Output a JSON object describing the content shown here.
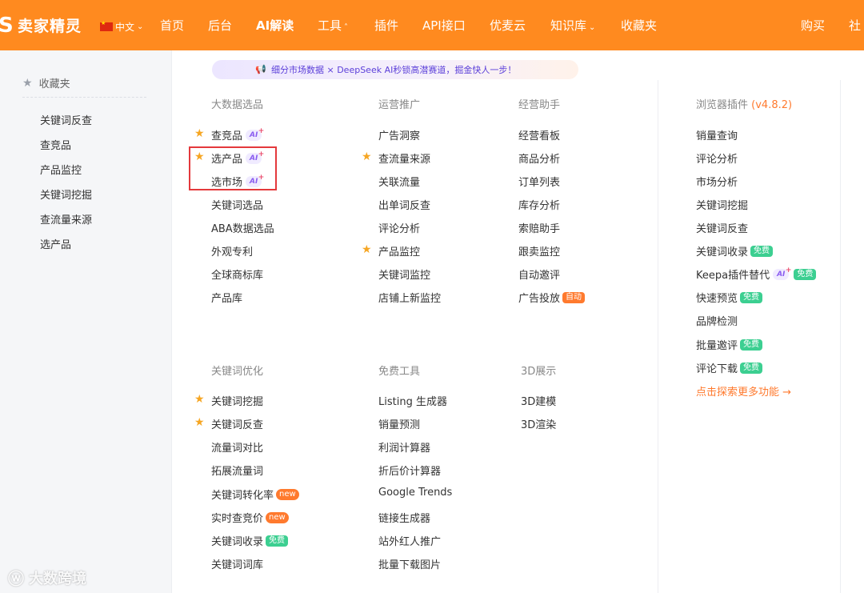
{
  "brand": {
    "name": "卖家精灵",
    "logo_letter": "S"
  },
  "lang": {
    "label": "中文"
  },
  "nav": [
    {
      "label": "首页"
    },
    {
      "label": "后台"
    },
    {
      "label": "AI解读"
    },
    {
      "label": "工具"
    },
    {
      "label": "插件"
    },
    {
      "label": "API接口"
    },
    {
      "label": "优麦云"
    },
    {
      "label": "知识库"
    },
    {
      "label": "收藏夹"
    },
    {
      "label": "购买"
    },
    {
      "label": "社"
    }
  ],
  "sidebar": {
    "title": "收藏夹",
    "items": [
      "关键词反查",
      "查竞品",
      "产品监控",
      "关键词挖掘",
      "查流量来源",
      "选产品"
    ]
  },
  "banner": {
    "text": "细分市场数据 × DeepSeek AI秒锁高潜赛道，掘金快人一步！"
  },
  "sections": {
    "bigdata": {
      "title": "大数据选品",
      "items": [
        "查竞品",
        "选产品",
        "选市场",
        "关键词选品",
        "ABA数据选品",
        "外观专利",
        "全球商标库",
        "产品库"
      ]
    },
    "ops": {
      "title": "运营推广",
      "items": [
        "广告洞察",
        "查流量来源",
        "关联流量",
        "出单词反查",
        "评论分析",
        "产品监控",
        "关键词监控",
        "店铺上新监控"
      ]
    },
    "biz": {
      "title": "经营助手",
      "items": [
        "经营看板",
        "商品分析",
        "订单列表",
        "库存分析",
        "索赔助手",
        "跟卖监控",
        "自动邀评",
        "广告投放"
      ]
    },
    "plugin": {
      "title": "浏览器插件",
      "version": "(v4.8.2)",
      "items": [
        "销量查询",
        "评论分析",
        "市场分析",
        "关键词挖掘",
        "关键词反查",
        "关键词收录",
        "Keepa插件替代",
        "快速预览",
        "品牌检测",
        "批量邀评",
        "评论下载"
      ],
      "more": "点击探索更多功能 →"
    },
    "kwopt": {
      "title": "关键词优化",
      "items": [
        "关键词挖掘",
        "关键词反查",
        "流量词对比",
        "拓展流量词",
        "关键词转化率",
        "实时查竞价",
        "关键词收录",
        "关键词词库"
      ]
    },
    "free": {
      "title": "免费工具",
      "items": [
        "Listing 生成器",
        "销量预测",
        "利润计算器",
        "折后价计算器",
        "Google Trends",
        "链接生成器",
        "站外红人推广",
        "批量下载图片"
      ]
    },
    "d3": {
      "title": "3D展示",
      "items": [
        "3D建模",
        "3D渲染"
      ]
    }
  },
  "tags": {
    "ai": "AI",
    "new": "new",
    "free": "免费",
    "auto": "自动"
  },
  "watermark": {
    "text": "大数跨境"
  },
  "colors": {
    "brand_orange": "#ff8a1f",
    "star": "#f6a623",
    "free_green": "#3ccf91",
    "highlight_red": "#e4393c"
  }
}
